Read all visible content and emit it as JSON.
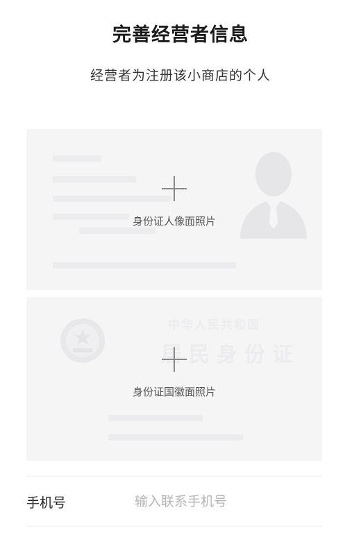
{
  "header": {
    "title": "完善经营者信息",
    "subtitle": "经营者为注册该小商店的个人"
  },
  "upload": {
    "front_label": "身份证人像面照片",
    "back_label": "身份证国徽面照片",
    "back_watermark_line1": "中华人民共和国",
    "back_watermark_line2": "居民身份证"
  },
  "form": {
    "phone_label": "手机号",
    "phone_placeholder": "输入联系手机号",
    "phone_value": ""
  },
  "colors": {
    "card_bg": "#f5f5f6",
    "placeholder": "#b5b5b5"
  }
}
